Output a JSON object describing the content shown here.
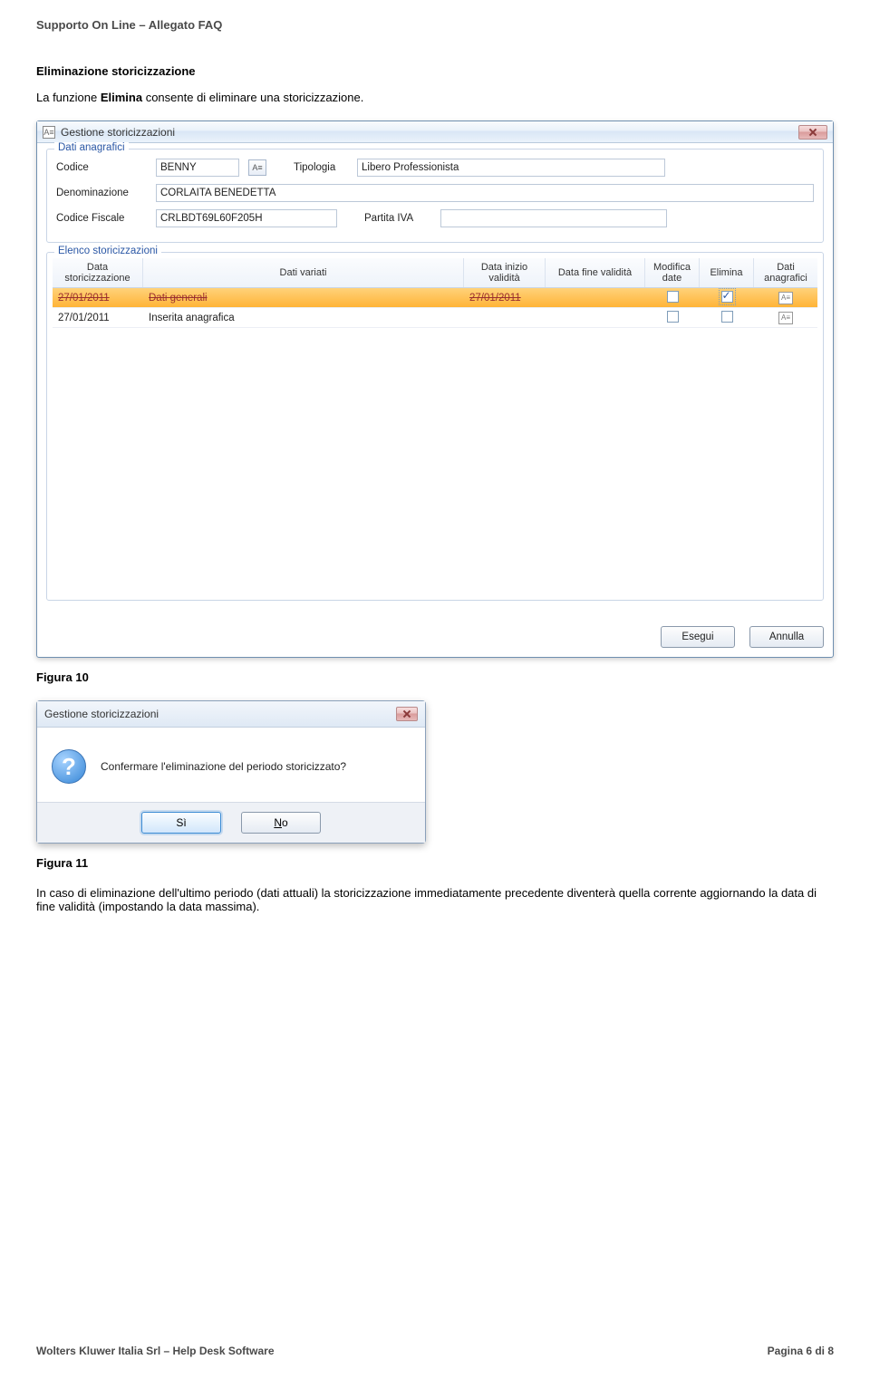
{
  "doc": {
    "header": "Supporto On Line – Allegato FAQ",
    "section_title": "Eliminazione storicizzazione",
    "intro_pre": "La funzione ",
    "intro_bold": "Elimina",
    "intro_post": " consente di eliminare una storicizzazione.",
    "footer_left": "Wolters Kluwer Italia Srl – Help Desk  Software",
    "footer_right": "Pagina 6 di 8"
  },
  "fig10": {
    "caption": "Figura 10",
    "window_title": "Gestione storicizzazioni",
    "group_anag": "Dati anagrafici",
    "labels": {
      "codice": "Codice",
      "tipologia": "Tipologia",
      "denominazione": "Denominazione",
      "codice_fiscale": "Codice Fiscale",
      "partita_iva": "Partita IVA"
    },
    "values": {
      "codice": "BENNY",
      "tipologia": "Libero Professionista",
      "denominazione": "CORLAITA BENEDETTA",
      "codice_fiscale": "CRLBDT69L60F205H",
      "partita_iva": ""
    },
    "group_elenco": "Elenco storicizzazioni",
    "columns": {
      "data_storicizzazione": "Data storicizzazione",
      "dati_variati": "Dati variati",
      "data_inizio": "Data inizio validità",
      "data_fine": "Data fine validità",
      "modifica_date": "Modifica date",
      "elimina": "Elimina",
      "dati_anag": "Dati anagrafici"
    },
    "rows": [
      {
        "data_st": "27/01/2011",
        "dati_variati": "Dati generali",
        "data_inizio": "27/01/2011",
        "data_fine": "",
        "modifica": false,
        "elimina": true,
        "selected": true
      },
      {
        "data_st": "27/01/2011",
        "dati_variati": "Inserita anagrafica",
        "data_inizio": "",
        "data_fine": "",
        "modifica": false,
        "elimina": false,
        "selected": false
      }
    ],
    "buttons": {
      "esegui": "Esegui",
      "annulla": "Annulla"
    }
  },
  "fig11": {
    "caption": "Figura 11",
    "title": "Gestione storicizzazioni",
    "question": "Confermare l'eliminazione del periodo storicizzato?",
    "yes": "Sì",
    "no_underline": "N",
    "no_rest": "o",
    "after": "In caso di eliminazione dell'ultimo periodo (dati attuali) la storicizzazione immediatamente precedente diventerà quella corrente aggiornando la data di fine validità (impostando la data massima)."
  }
}
